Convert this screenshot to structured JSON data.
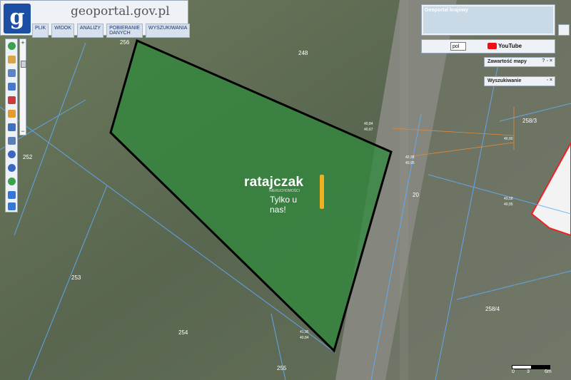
{
  "app": {
    "title": "geoportal.gov.pl",
    "logo_letter": "g",
    "menu": [
      "PLIK",
      "WIDOK",
      "ANALIZY",
      "POBIERANIE DANYCH",
      "WYSZUKIWANIA"
    ]
  },
  "right_panel": {
    "title": "Geoportal krajowy",
    "language": "pol",
    "youtube": "YouTube",
    "content_panel": "Zawartość mapy",
    "search_panel": "Wyszukiwanie"
  },
  "parcels": [
    "256",
    "248",
    "252",
    "253",
    "254",
    "255",
    "258/3",
    "258/4",
    "20"
  ],
  "annotations": [
    "40,84",
    "40,67",
    "42,28",
    "40,95",
    "43,58",
    "40,95",
    "41,95",
    "40,84",
    "40,90"
  ],
  "watermark": {
    "brand": "ratajczak",
    "sub": "NIERUCHOMOŚCI",
    "tagline": "Tylko u nas!"
  },
  "scale": {
    "labels": [
      "0",
      "3",
      "6m"
    ]
  },
  "colors": {
    "parcel_fill": "#2e8a3c",
    "boundary": "#000000",
    "lines": "#5fb0ff",
    "accent": "#2b5db5"
  }
}
